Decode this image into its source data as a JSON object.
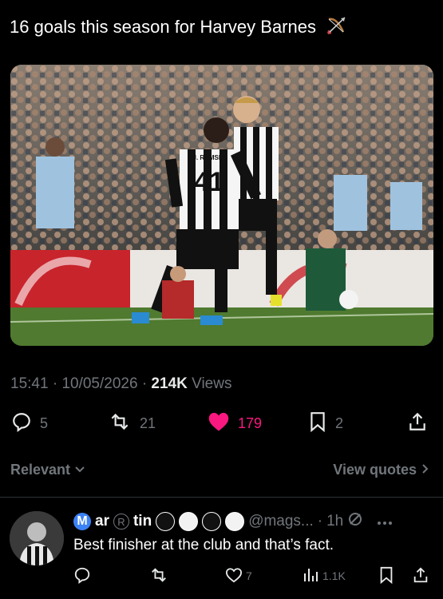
{
  "tweet": {
    "text": "16 goals this season for Harvey Barnes",
    "time": "15:41",
    "date": "10/05/2026",
    "views_count": "214K",
    "views_label": "Views"
  },
  "photo": {
    "shirt_number": "41",
    "shirt_name": "J. RAMSEY"
  },
  "actions": {
    "replies": "5",
    "reposts": "21",
    "likes": "179",
    "bookmarks": "2"
  },
  "colors": {
    "like": "#f91880",
    "muted": "#71767b",
    "verified": "#3b82f6"
  },
  "sort": {
    "relevant_label": "Relevant",
    "view_quotes_label": "View quotes"
  },
  "reply": {
    "name_part1": "ar",
    "name_part2": "tin",
    "name_badge": "M",
    "registered_badge": "R",
    "handle": "@mags...",
    "time": "1h",
    "text": "Best finisher at the club and that’s fact.",
    "likes": "7",
    "views": "1.1K"
  }
}
